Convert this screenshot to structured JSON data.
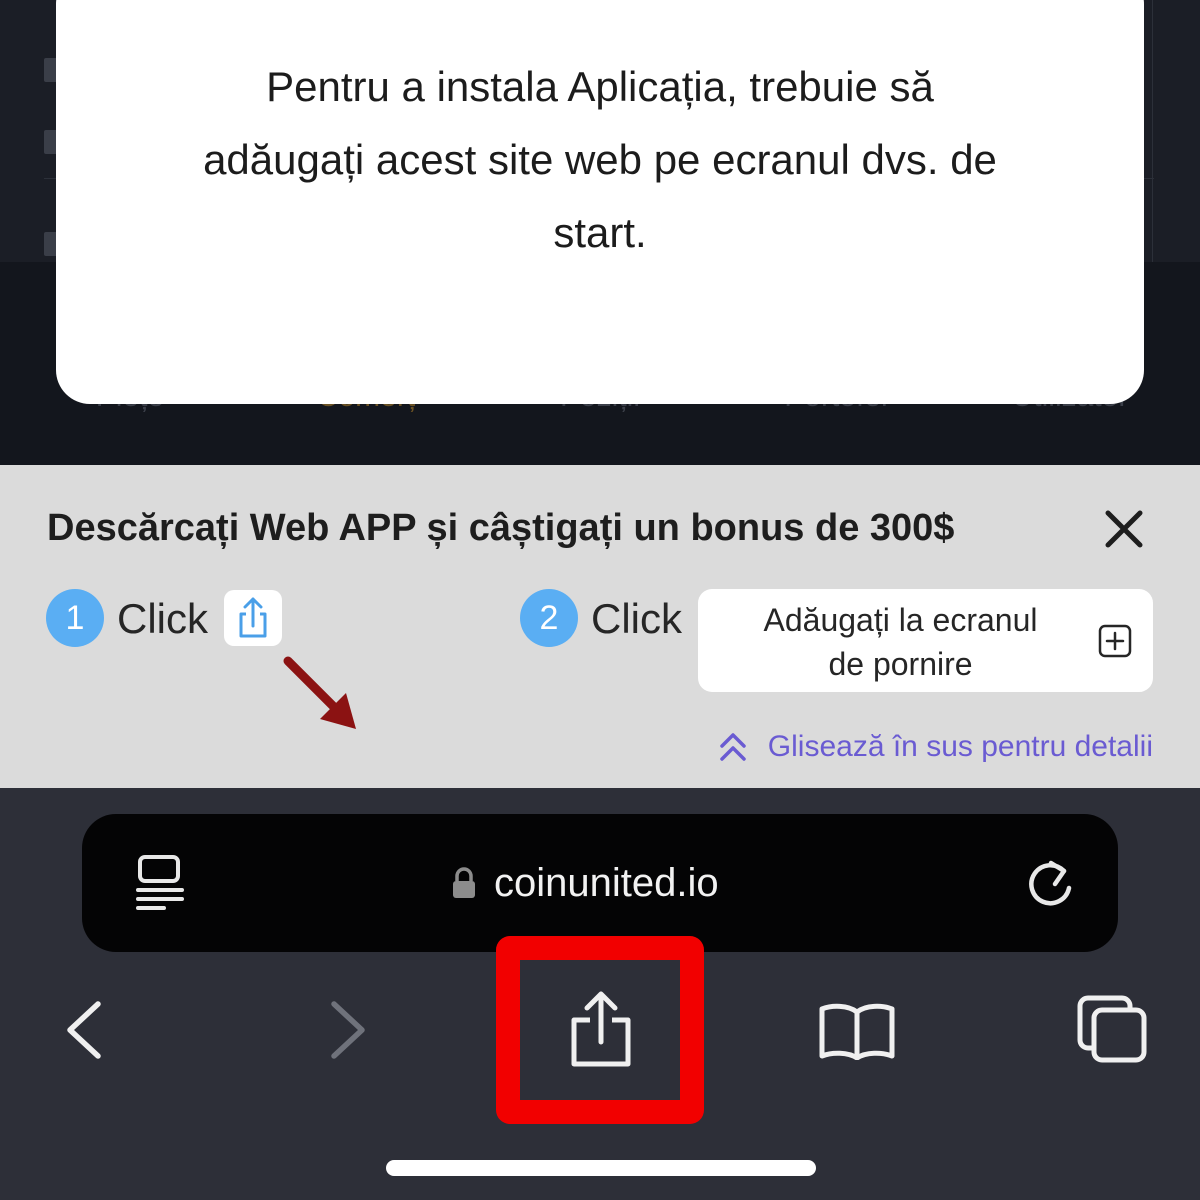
{
  "background_app": {
    "nav_items": [
      {
        "label": "Piețe",
        "active": false
      },
      {
        "label": "Comerț",
        "active": true
      },
      {
        "label": "Poziții",
        "active": false
      },
      {
        "label": "Portofel",
        "active": false
      },
      {
        "label": "Utilizator",
        "active": false
      }
    ]
  },
  "modal": {
    "message_line1": "Pentru a instala Aplicația, trebuie să",
    "message_line2": "adăugați acest site web pe ecranul dvs. de",
    "message_line3": "start."
  },
  "promo": {
    "title": "Descărcați Web APP și câștigați un bonus de 300$",
    "close_icon": "close-icon",
    "step1": {
      "number": "1",
      "label": "Click",
      "icon": "share-icon"
    },
    "step2": {
      "number": "2",
      "label": "Click",
      "button_line1": "Adăugați la ecranul",
      "button_line2": "de pornire",
      "icon": "add-square-icon"
    },
    "swipe_hint": "Glisează în sus pentru detalii"
  },
  "browser": {
    "url": "coinunited.io",
    "toolbar": [
      "back-icon",
      "forward-icon",
      "share-icon",
      "bookmarks-icon",
      "tabs-icon"
    ]
  },
  "colors": {
    "accent_blue": "#5aaef3",
    "swipe_purple": "#6a5bd2",
    "highlight_red": "#f20000",
    "active_nav_gold": "#6b5224"
  }
}
